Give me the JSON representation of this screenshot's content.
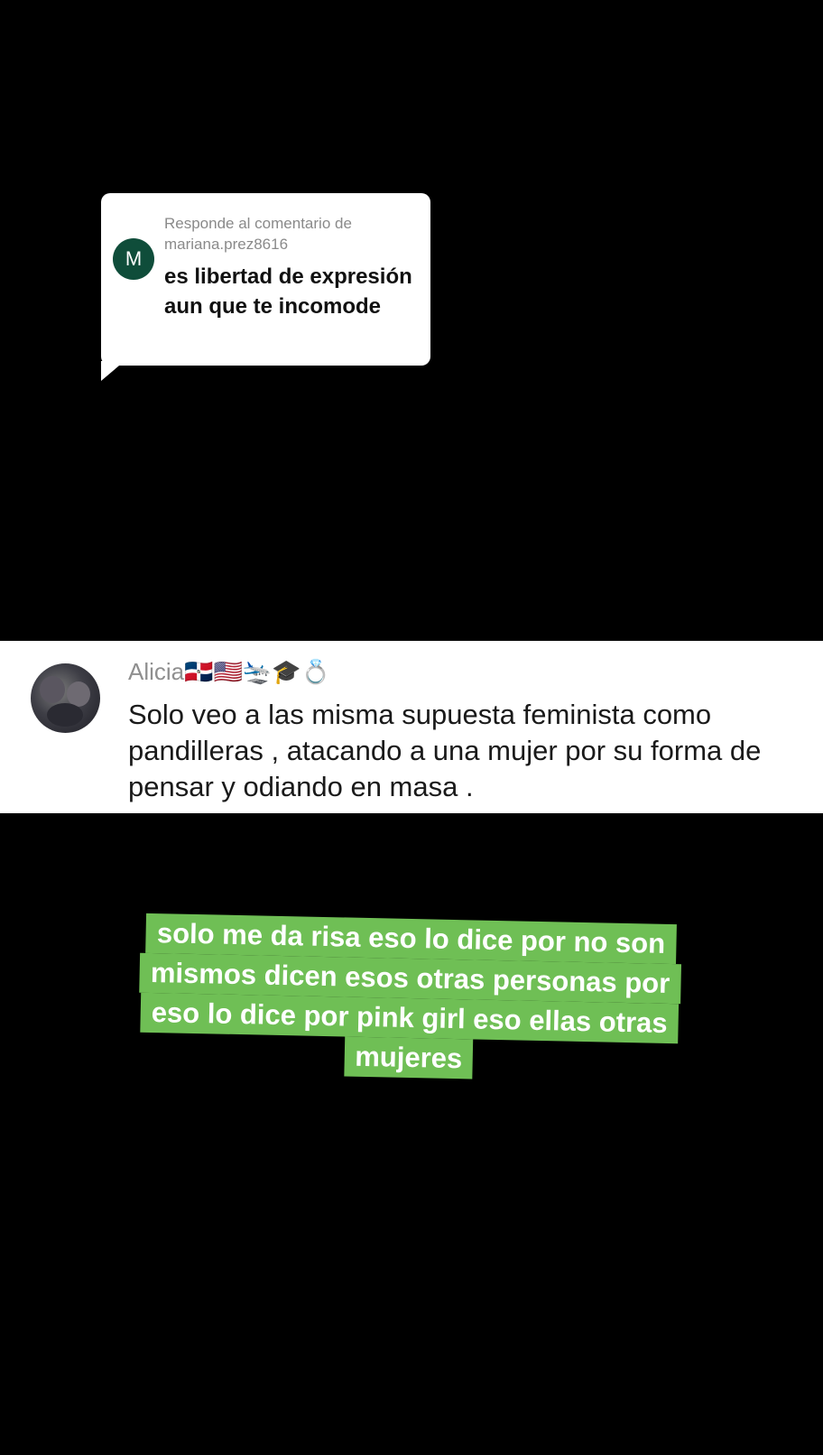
{
  "reply": {
    "header_line1": "Responde al comentario de",
    "header_line2": "mariana.prez8616",
    "avatar_letter": "M",
    "avatar_color": "#0f4d3a",
    "text": "es libertad de expresión aun que te incomode"
  },
  "comment": {
    "username": "Alicia🇩🇴🇺🇸🛬🎓💍",
    "text": "Solo veo a las misma supuesta feminista como pandilleras , atacando a una mujer por su forma de pensar y odiando en masa ."
  },
  "caption": {
    "highlight_color": "#6fbf55",
    "lines": [
      "solo me da risa eso lo dice por no son",
      "mismos dicen esos otras personas por",
      "eso lo dice por pink girl eso ellas otras",
      "mujeres"
    ]
  }
}
